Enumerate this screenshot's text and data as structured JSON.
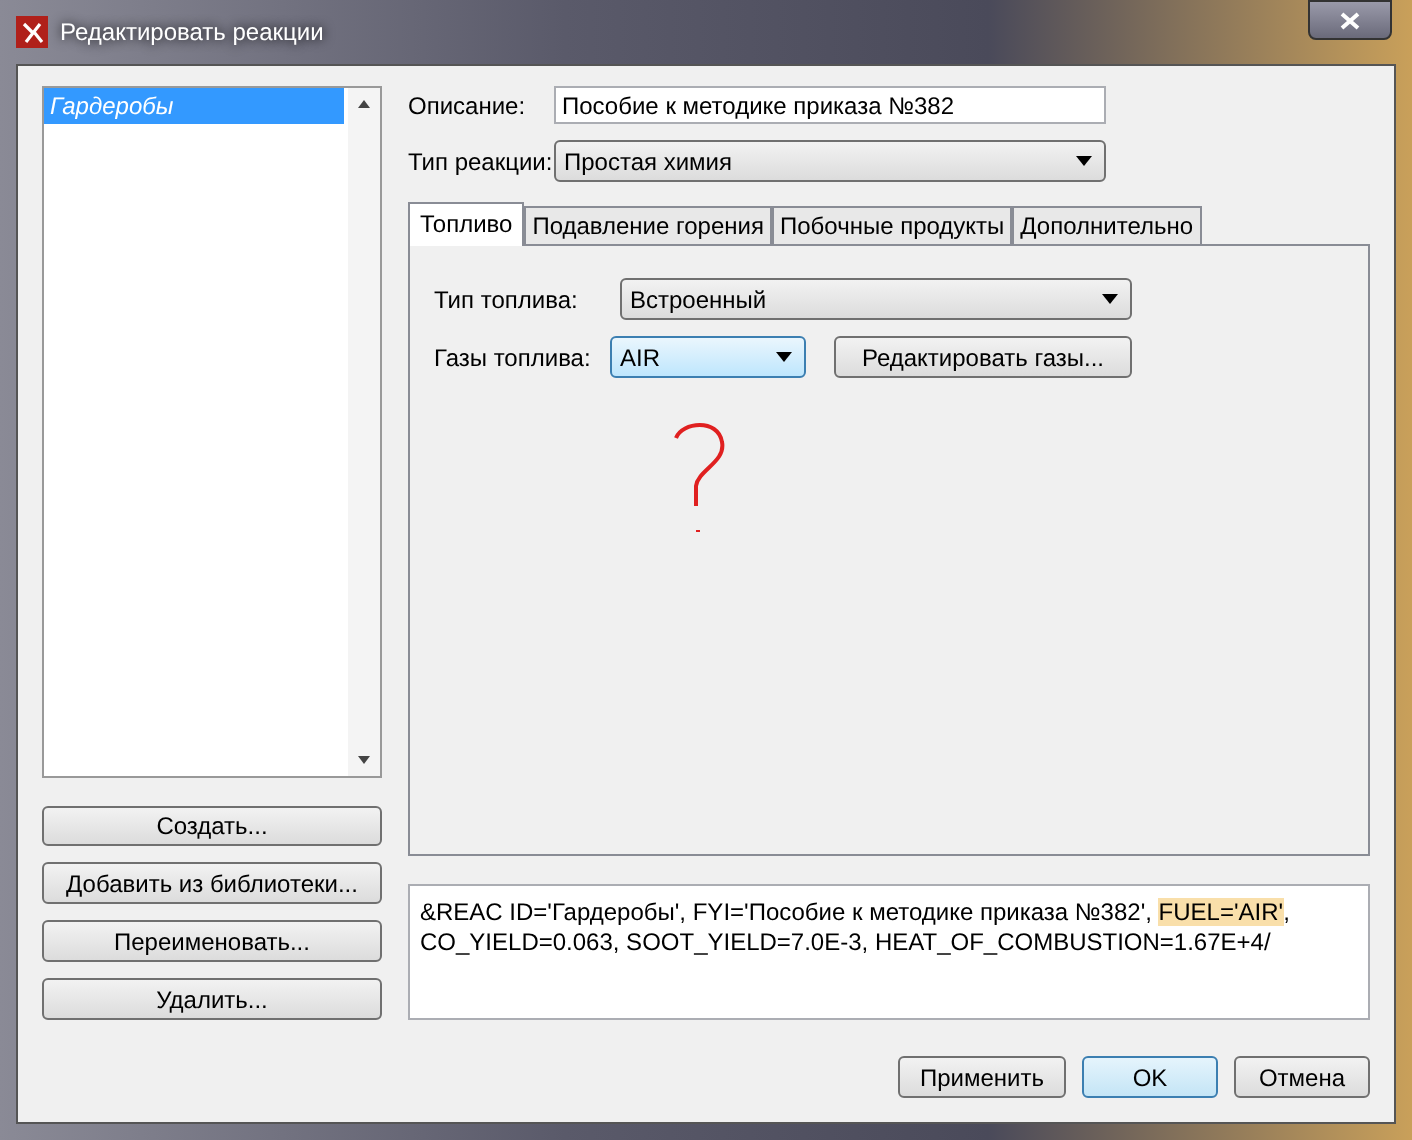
{
  "window": {
    "title": "Редактировать реакции"
  },
  "reactions": {
    "items": [
      {
        "label": "Гардеробы",
        "selected": true
      }
    ]
  },
  "left_buttons": [
    "Создать...",
    "Добавить из библиотеки...",
    "Переименовать...",
    "Удалить..."
  ],
  "description": {
    "label": "Описание:",
    "value": "Пособие к методике приказа №382"
  },
  "reaction_type": {
    "label": "Тип реакции:",
    "value": "Простая химия"
  },
  "tabs": [
    {
      "label": "Топливо",
      "selected": true
    },
    {
      "label": "Подавление горения",
      "selected": false
    },
    {
      "label": "Побочные продукты",
      "selected": false
    },
    {
      "label": "Дополнительно",
      "selected": false
    }
  ],
  "fuel_type": {
    "label": "Тип топлива:",
    "value": "Встроенный"
  },
  "fuel_gases": {
    "label": "Газы топлива:",
    "value": "AIR",
    "button": "Редактировать газы..."
  },
  "code": [
    {
      "text": "&REAC ID='Гардеробы', FYI='Пособие к методике приказа №382', ",
      "highlighted": false
    },
    {
      "text": "FUEL='AIR'",
      "highlighted": true
    },
    {
      "text": ", CO_YIELD=0.063, SOOT_YIELD=7.0E-3, HEAT_OF_COMBUSTION=1.67E+4/",
      "highlighted": false
    }
  ],
  "buttons": [
    {
      "label": "Применить",
      "default": false
    },
    {
      "label": "OK",
      "default": true
    },
    {
      "label": "Отмена",
      "default": false
    }
  ]
}
